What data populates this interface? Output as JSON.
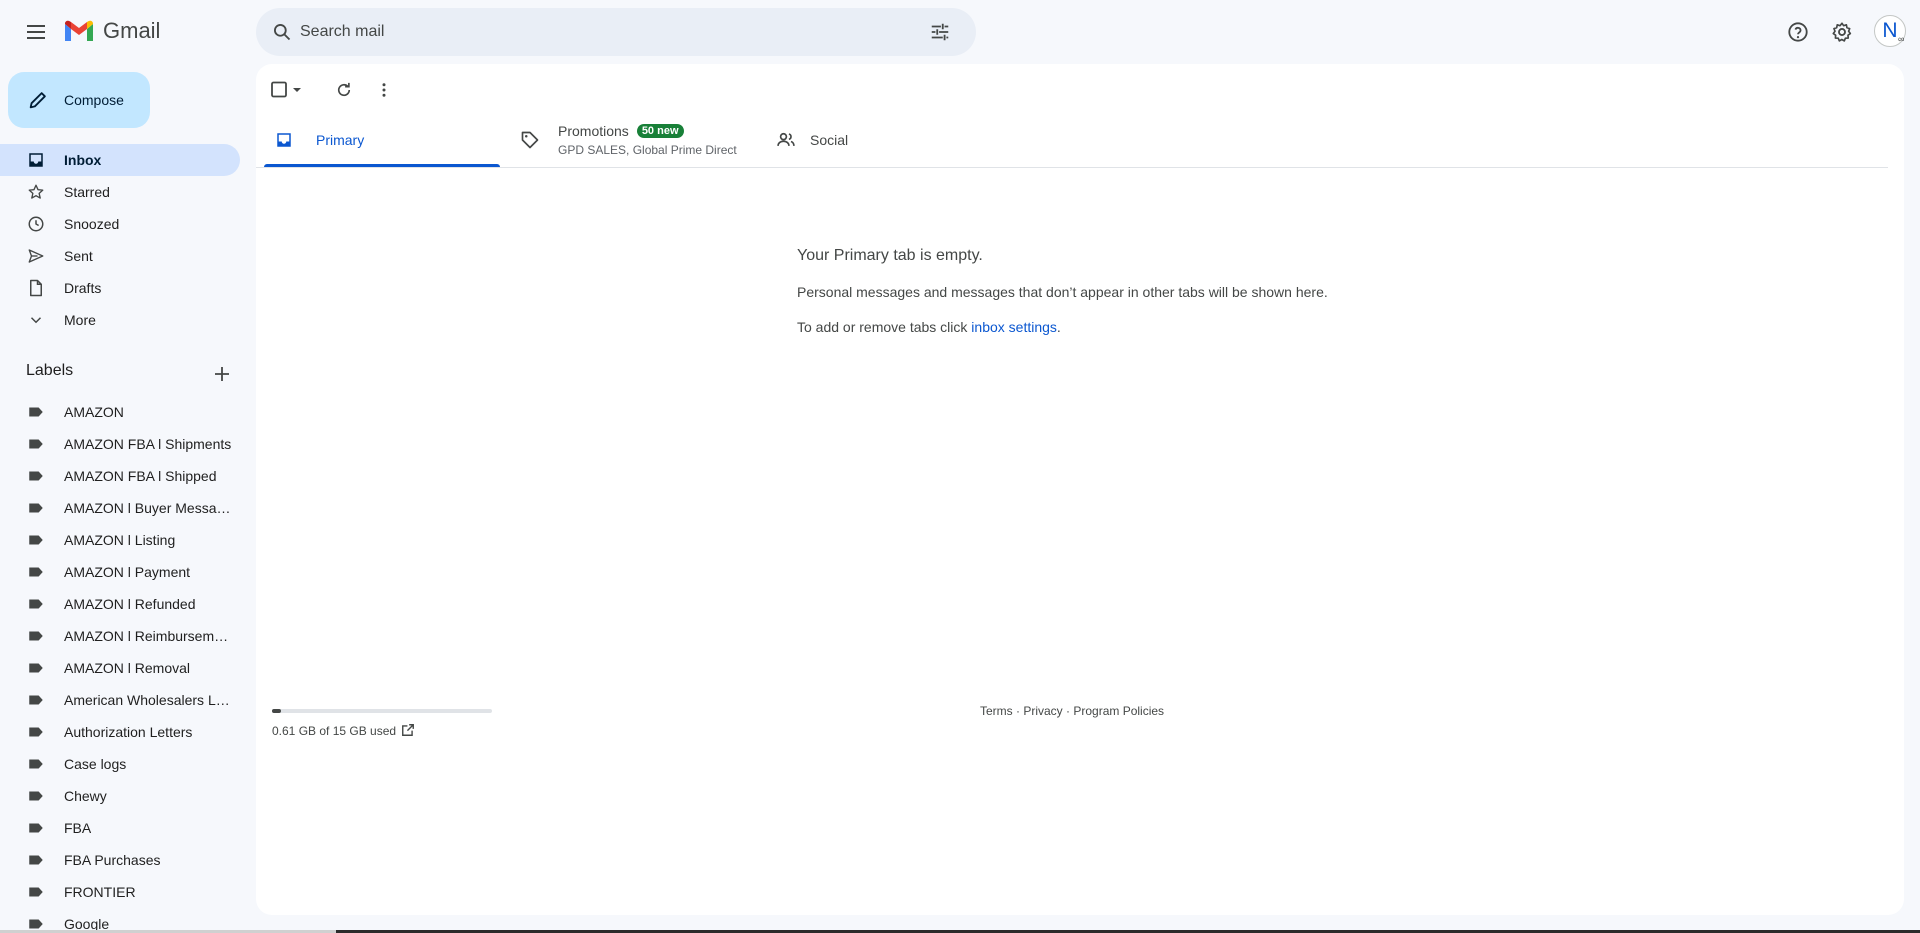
{
  "header": {
    "app_name": "Gmail",
    "search_placeholder": "Search mail",
    "avatar_initial": "N",
    "avatar_badge": "∞"
  },
  "compose": {
    "label": "Compose"
  },
  "nav": [
    {
      "label": "Inbox",
      "icon": "inbox-icon",
      "active": true
    },
    {
      "label": "Starred",
      "icon": "star-icon"
    },
    {
      "label": "Snoozed",
      "icon": "clock-icon"
    },
    {
      "label": "Sent",
      "icon": "send-icon"
    },
    {
      "label": "Drafts",
      "icon": "draft-icon"
    },
    {
      "label": "More",
      "icon": "chevron-down-icon"
    }
  ],
  "labels": {
    "title": "Labels",
    "items": [
      "AMAZON",
      "AMAZON FBA l Shipments",
      "AMAZON FBA l Shipped",
      "AMAZON l Buyer Messages",
      "AMAZON l Listing",
      "AMAZON l Payment",
      "AMAZON l Refunded",
      "AMAZON l Reimbursement",
      "AMAZON l Removal",
      "American Wholesalers LLC",
      "Authorization Letters",
      "Case logs",
      "Chewy",
      "FBA",
      "FBA Purchases",
      "FRONTIER",
      "Google"
    ]
  },
  "tabs": {
    "primary": {
      "label": "Primary"
    },
    "promotions": {
      "label": "Promotions",
      "badge": "50 new",
      "subtitle": "GPD SALES, Global Prime Direct"
    },
    "social": {
      "label": "Social"
    }
  },
  "empty_state": {
    "title": "Your Primary tab is empty.",
    "description": "Personal messages and messages that don’t appear in other tabs will be shown here.",
    "settings_prefix": "To add or remove tabs click ",
    "settings_link": "inbox settings",
    "settings_suffix": "."
  },
  "storage": {
    "used_text": "0.61 GB of 15 GB used",
    "used_fraction": 0.04
  },
  "footer": {
    "terms": "Terms",
    "privacy": "Privacy",
    "policies": "Program Policies",
    "separator": " · "
  },
  "colors": {
    "accent": "#0b57d0",
    "compose_bg": "#c2e7ff",
    "active_nav_bg": "#d3e3fd",
    "badge_green": "#188038"
  }
}
